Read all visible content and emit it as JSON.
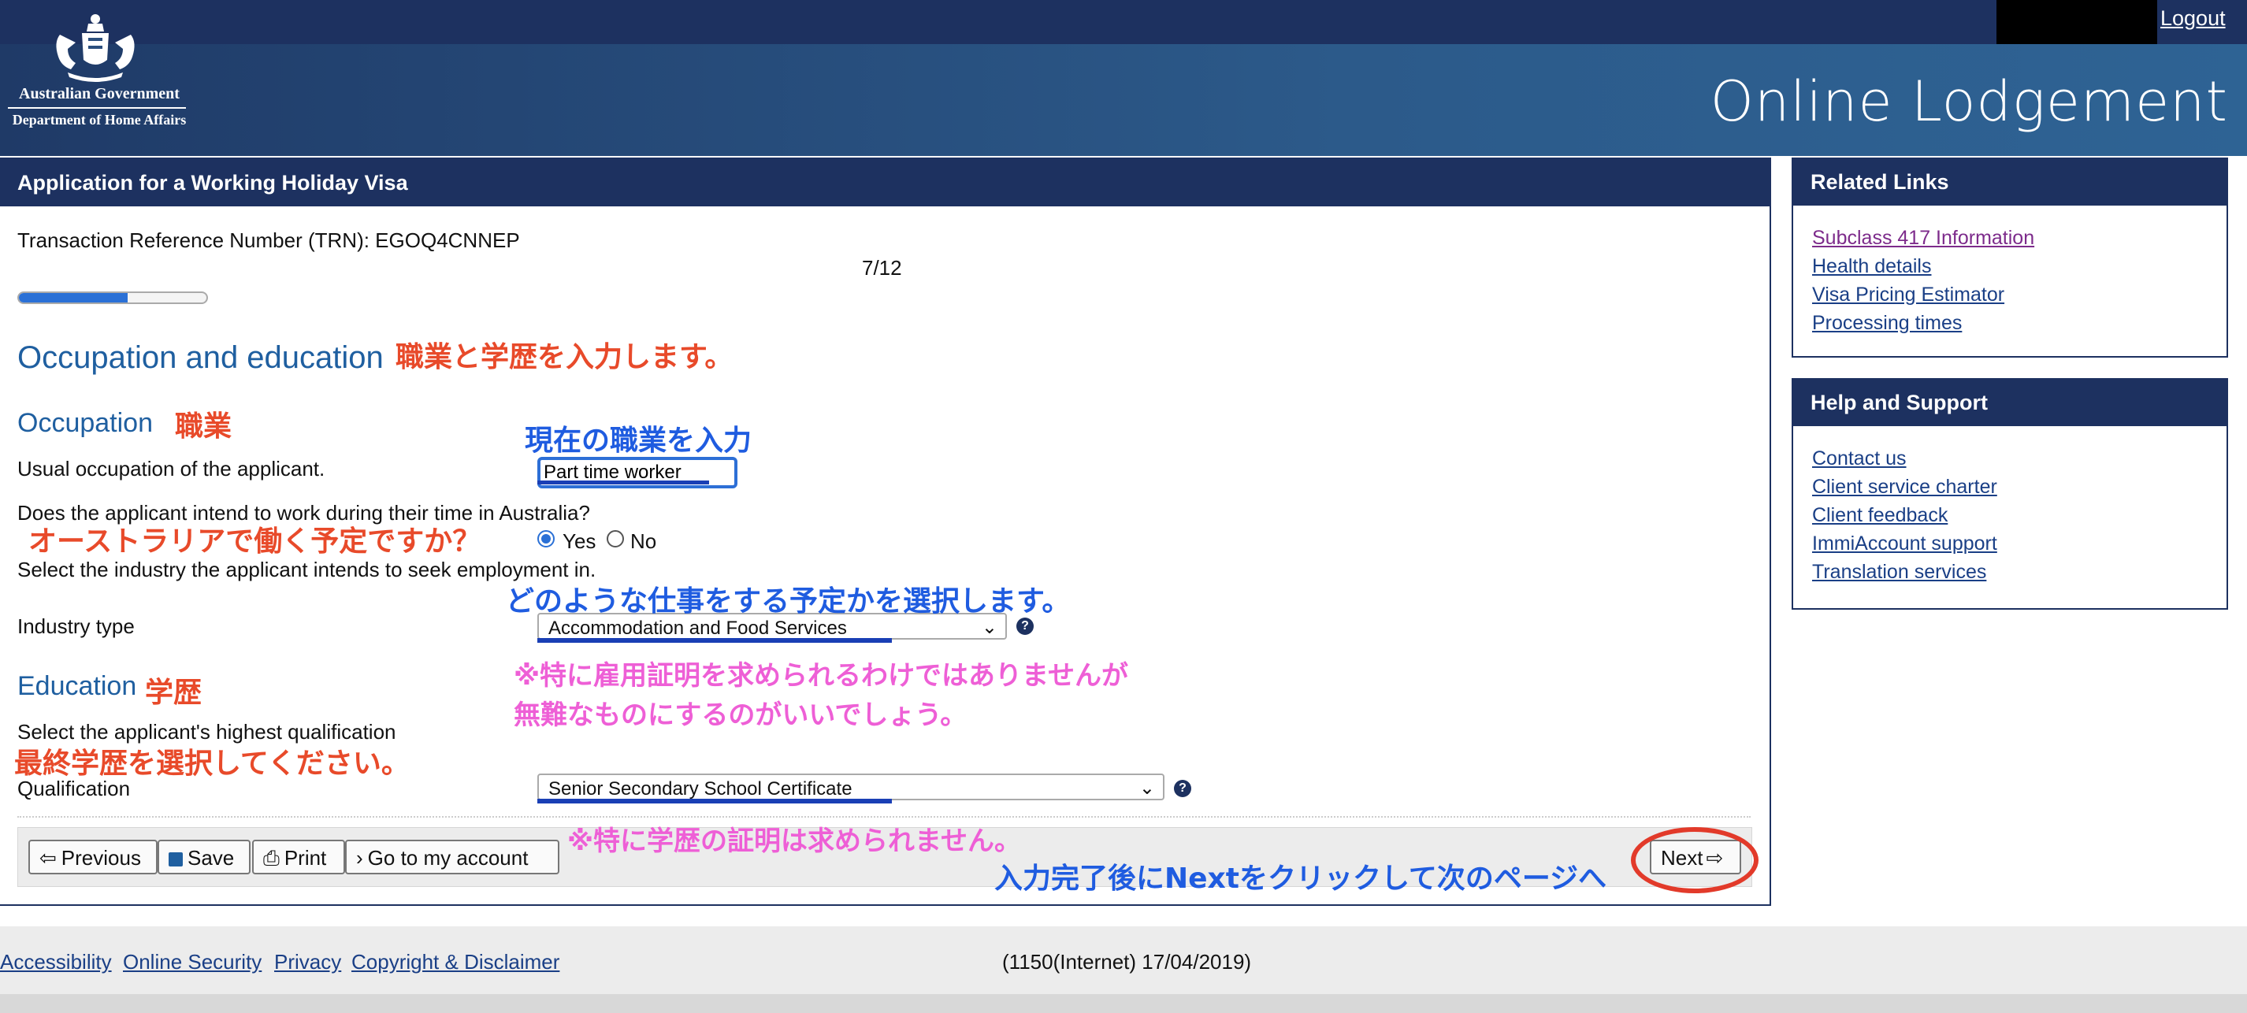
{
  "header": {
    "logout": "Logout",
    "site_title": "Online Lodgement",
    "gov_name": "Australian Government",
    "dept_name": "Department of Home Affairs"
  },
  "form": {
    "panel_title": "Application for a Working Holiday Visa",
    "trn": "Transaction Reference Number (TRN): EGOQ4CNNEP",
    "step": "7/12",
    "progress_fraction": 0.58,
    "section_title": "Occupation and education",
    "occupation_heading": "Occupation",
    "occupation_question": "Usual occupation of the applicant.",
    "occupation_value": "Part time worker",
    "work_question": "Does the applicant intend to work during their time in Australia?",
    "yes_label": "Yes",
    "no_label": "No",
    "work_selected": "Yes",
    "industry_question": "Select the industry the applicant intends to seek employment in.",
    "industry_label": "Industry type",
    "industry_value": "Accommodation and Food Services",
    "education_heading": "Education",
    "qualification_question": "Select the applicant's highest qualification",
    "qualification_label": "Qualification",
    "qualification_value": "Senior Secondary School Certificate",
    "help_glyph": "?"
  },
  "nav": {
    "previous": "Previous",
    "save": "Save",
    "print": "Print",
    "account": "Go to my account",
    "next": "Next"
  },
  "related_links": {
    "title": "Related Links",
    "items": [
      "Subclass 417 Information",
      "Health details",
      "Visa Pricing Estimator",
      "Processing times"
    ]
  },
  "help_support": {
    "title": "Help and Support",
    "items": [
      "Contact us",
      "Client service charter",
      "Client feedback",
      "ImmiAccount support",
      "Translation services"
    ]
  },
  "footer": {
    "links": [
      "Accessibility",
      "Online Security",
      "Privacy",
      "Copyright & Disclaimer"
    ],
    "version": "(1150(Internet) 17/04/2019)"
  },
  "annotations": {
    "section": "職業と学歴を入力します。",
    "occupation": "職業",
    "occupation_input": "現在の職業を入力",
    "work": "オーストラリアで働く予定ですか？",
    "industry": "どのような仕事をする予定かを選択します。",
    "industry_note_1": "※特に雇用証明を求められるわけではありませんが",
    "industry_note_2": "無難なものにするのがいいでしょう。",
    "education": "学歴",
    "qualification": "最終学歴を選択してください。",
    "qualification_note": "※特に学歴の証明は求められません。",
    "next": "入力完了後にNextをクリックして次のページへ"
  },
  "colors": {
    "navy": "#1d3160",
    "annotation_red": "#e84a2a",
    "annotation_blue": "#1f5ce0",
    "annotation_pink": "#ee5fd6",
    "highlight_circle": "#e23a2a"
  }
}
